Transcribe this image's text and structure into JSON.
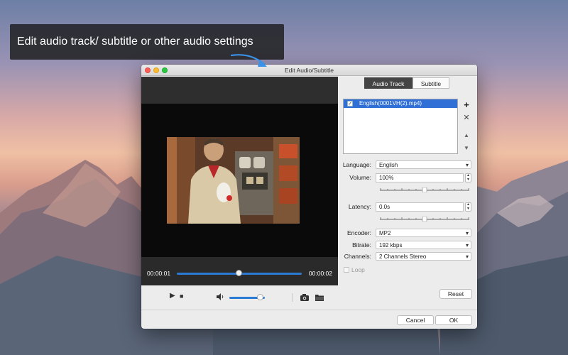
{
  "banner": {
    "text": "Edit audio track/ subtitle or other audio settings"
  },
  "window": {
    "title": "Edit Audio/Subtitle"
  },
  "player": {
    "current_time": "00:00:01",
    "total_time": "00:00:02",
    "seek_progress": 0.5,
    "volume_level": 0.88
  },
  "tabs": [
    {
      "label": "Audio Track",
      "active": true
    },
    {
      "label": "Subtitle",
      "active": false
    }
  ],
  "tracks": [
    {
      "label": "English(0001VH(2).mp4)",
      "checked": true,
      "selected": true
    }
  ],
  "settings": {
    "language_label": "Language:",
    "language_value": "English",
    "volume_label": "Volume:",
    "volume_value": "100%",
    "latency_label": "Latency:",
    "latency_value": "0.0s",
    "encoder_label": "Encoder:",
    "encoder_value": "MP2",
    "bitrate_label": "Bitrate:",
    "bitrate_value": "192 kbps",
    "channels_label": "Channels:",
    "channels_value": "2 Channels Stereo",
    "loop_label": "Loop"
  },
  "buttons": {
    "reset": "Reset",
    "cancel": "Cancel",
    "ok": "OK"
  },
  "icons": {
    "add": "plus-icon",
    "remove": "close-icon",
    "up": "arrow-up-icon",
    "down": "arrow-down-icon",
    "play": "play-icon",
    "stop": "stop-icon",
    "volume": "speaker-icon",
    "snapshot": "camera-icon",
    "folder": "folder-icon"
  },
  "colors": {
    "accent": "#2b7bd4",
    "selection": "#2f6fd6",
    "tab_active": "#444444"
  }
}
